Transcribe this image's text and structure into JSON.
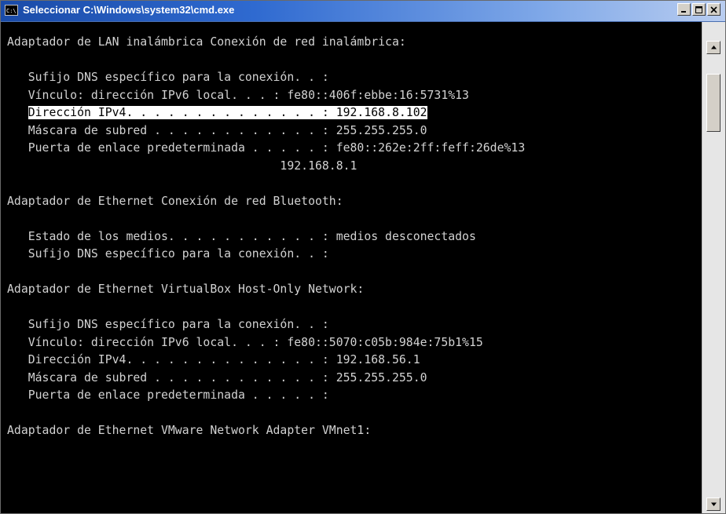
{
  "window": {
    "title": "Seleccionar C:\\Windows\\system32\\cmd.exe",
    "icon": "cmd-icon",
    "icon_text": "C:\\",
    "buttons": [
      "minimize-icon",
      "maximize-icon",
      "close-icon"
    ]
  },
  "console": {
    "lines": [
      "Adaptador de LAN inalámbrica Conexión de red inalámbrica:",
      "",
      "   Sufijo DNS específico para la conexión. . :",
      "   Vínculo: dirección IPv6 local. . . : fe80::406f:ebbe:16:5731%13",
      "   Dirección IPv4. . . . . . . . . . . . . . : 192.168.8.102",
      "   Máscara de subred . . . . . . . . . . . . : 255.255.255.0",
      "   Puerta de enlace predeterminada . . . . . : fe80::262e:2ff:feff:26de%13",
      "                                       192.168.8.1",
      "",
      "Adaptador de Ethernet Conexión de red Bluetooth:",
      "",
      "   Estado de los medios. . . . . . . . . . . : medios desconectados",
      "   Sufijo DNS específico para la conexión. . :",
      "",
      "Adaptador de Ethernet VirtualBox Host-Only Network:",
      "",
      "   Sufijo DNS específico para la conexión. . :",
      "   Vínculo: dirección IPv6 local. . . : fe80::5070:c05b:984e:75b1%15",
      "   Dirección IPv4. . . . . . . . . . . . . . : 192.168.56.1",
      "   Máscara de subred . . . . . . . . . . . . : 255.255.255.0",
      "   Puerta de enlace predeterminada . . . . . :",
      "",
      "Adaptador de Ethernet VMware Network Adapter VMnet1:"
    ],
    "selected_line_prefix": "   ",
    "selected_text": "Dirección IPv4. . . . . . . . . . . . . . : 192.168.8.102",
    "colors": {
      "background": "#000000",
      "text": "#d2d2d2",
      "selection_bg": "#ffffff",
      "selection_fg": "#000000"
    }
  },
  "scrollbar": {
    "up_icon": "scroll-up-arrow-icon",
    "down_icon": "scroll-down-arrow-icon"
  }
}
